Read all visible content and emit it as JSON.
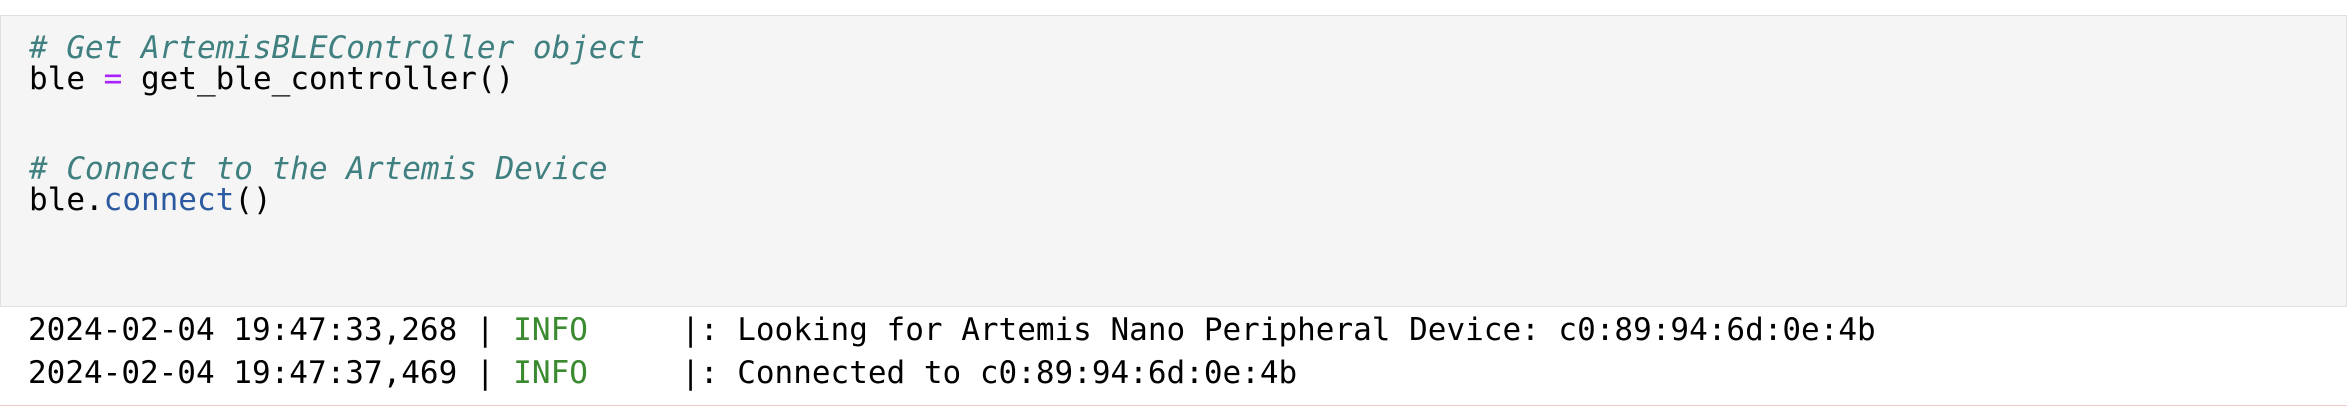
{
  "code_cell": {
    "lines": [
      {
        "type": "comment",
        "text": "# Get ArtemisBLEController object"
      },
      {
        "type": "assign",
        "var": "ble",
        "op": "=",
        "call": "get_ble_controller()"
      },
      {
        "type": "blank",
        "text": ""
      },
      {
        "type": "blank",
        "text": ""
      },
      {
        "type": "comment",
        "text": "# Connect to the Artemis Device"
      },
      {
        "type": "method",
        "obj": "ble.",
        "method": "connect",
        "args": "()"
      }
    ]
  },
  "output": {
    "lines": [
      {
        "timestamp": "2024-02-04 19:47:33,268",
        "sep1": " | ",
        "level": "INFO",
        "sep2": "     |: ",
        "message": "Looking for Artemis Nano Peripheral Device: c0:89:94:6d:0e:4b"
      },
      {
        "timestamp": "2024-02-04 19:47:37,469",
        "sep1": " | ",
        "level": "INFO",
        "sep2": "     |: ",
        "message": "Connected to c0:89:94:6d:0e:4b"
      }
    ]
  },
  "colors": {
    "cell_background": "#f5f5f5",
    "comment": "#408080",
    "operator": "#aa22ff",
    "method": "#2c5aa0",
    "log_level_info": "#3a8a2f"
  }
}
